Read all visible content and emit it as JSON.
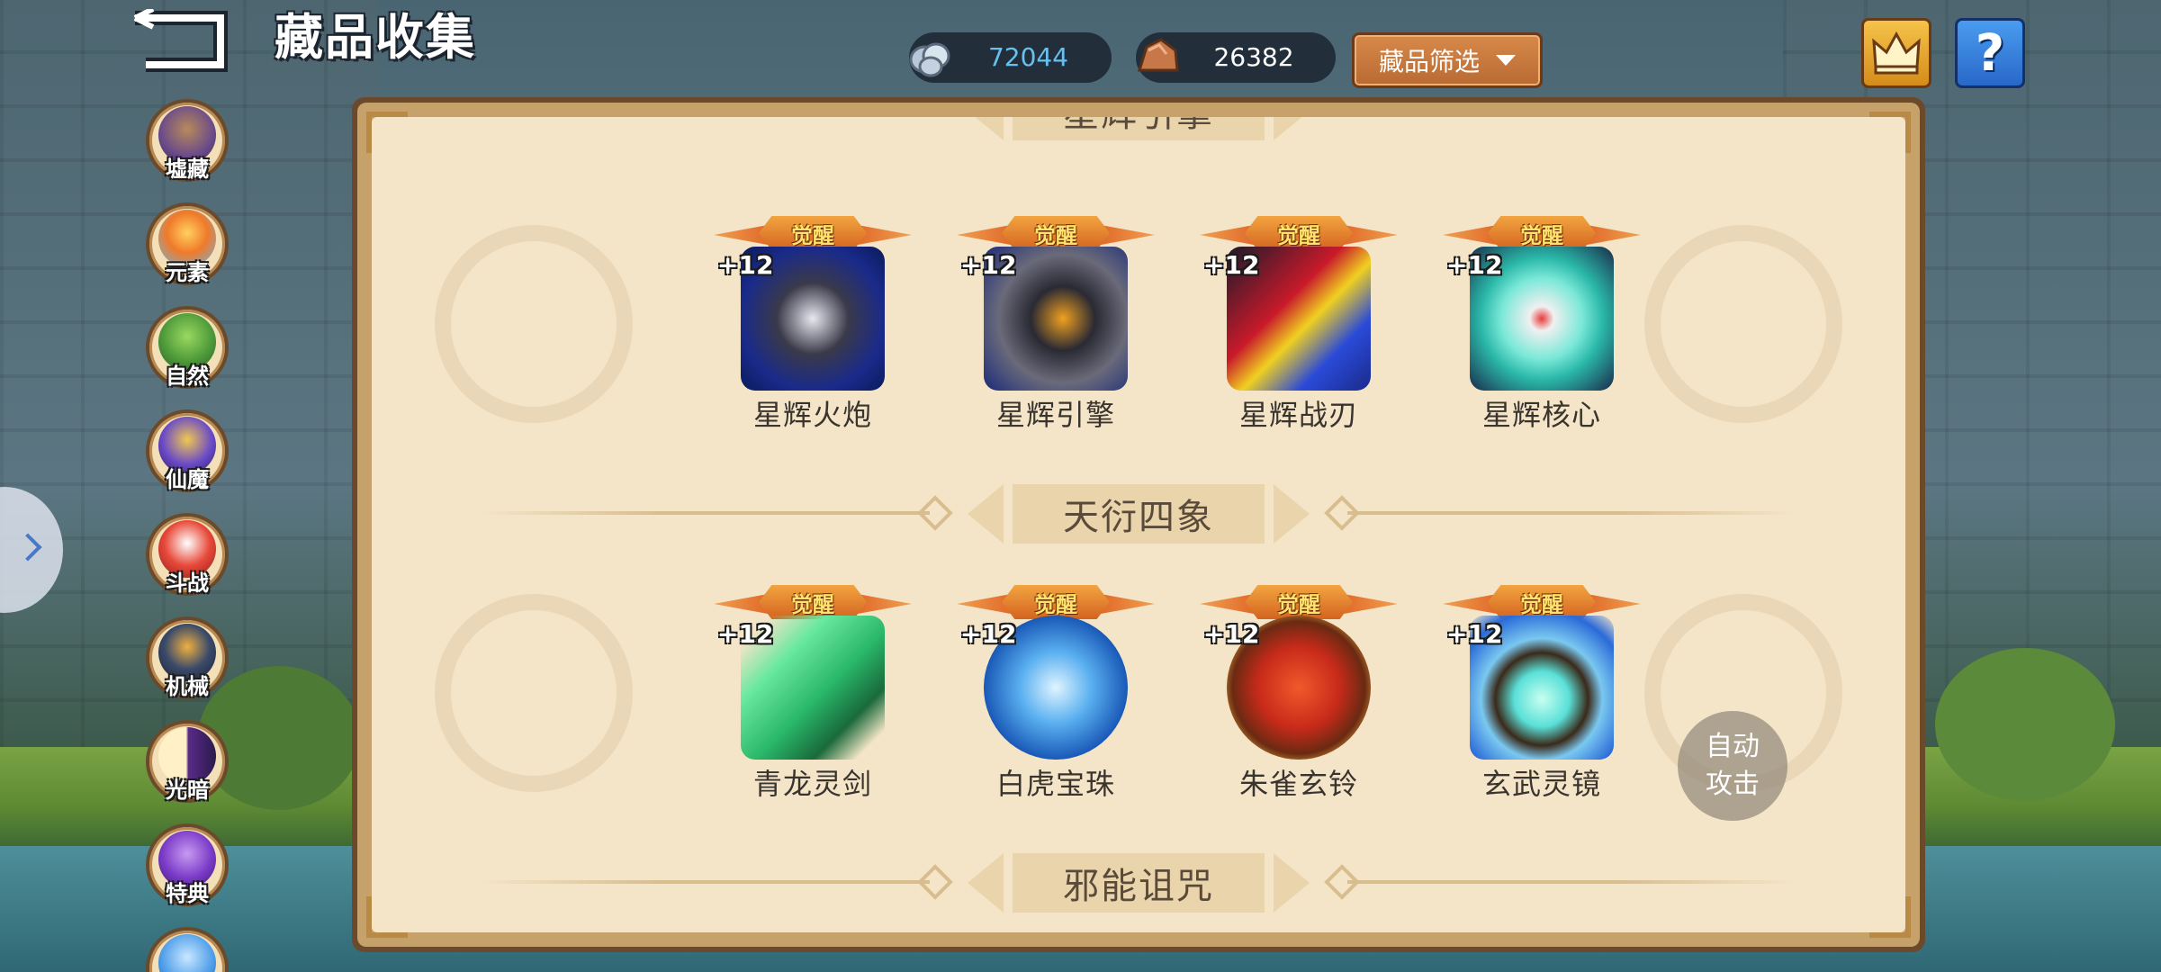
{
  "header": {
    "title": "藏品收集",
    "back_icon": "back-arrow-icon"
  },
  "currencies": [
    {
      "icon": "silver-ore-icon",
      "value": "72044",
      "color": "#67c0f0"
    },
    {
      "icon": "copper-ore-icon",
      "value": "26382",
      "color": "#ffffff"
    }
  ],
  "filter": {
    "label": "藏品筛选",
    "icon": "chevron-down-icon"
  },
  "top_buttons": {
    "crown_icon": "crown-icon",
    "help_label": "?"
  },
  "sidebar": {
    "items": [
      {
        "label": "墟藏",
        "icon": "treasure-chest-icon"
      },
      {
        "label": "元素",
        "icon": "element-flame-icon"
      },
      {
        "label": "自然",
        "icon": "tree-icon"
      },
      {
        "label": "仙魔",
        "icon": "demon-icon"
      },
      {
        "label": "斗战",
        "icon": "battle-orb-icon"
      },
      {
        "label": "机械",
        "icon": "mech-icon"
      },
      {
        "label": "光暗",
        "icon": "light-dark-icon"
      },
      {
        "label": "特典",
        "icon": "special-die-icon"
      }
    ],
    "expand_icon": "chevron-right-icon"
  },
  "sections": [
    {
      "title": "星辉引擎",
      "items": [
        {
          "name": "星辉火炮",
          "badge": "觉醒",
          "level": "+12"
        },
        {
          "name": "星辉引擎",
          "badge": "觉醒",
          "level": "+12"
        },
        {
          "name": "星辉战刃",
          "badge": "觉醒",
          "level": "+12"
        },
        {
          "name": "星辉核心",
          "badge": "觉醒",
          "level": "+12"
        }
      ]
    },
    {
      "title": "天衍四象",
      "items": [
        {
          "name": "青龙灵剑",
          "badge": "觉醒",
          "level": "+12"
        },
        {
          "name": "白虎宝珠",
          "badge": "觉醒",
          "level": "+12"
        },
        {
          "name": "朱雀玄铃",
          "badge": "觉醒",
          "level": "+12"
        },
        {
          "name": "玄武灵镜",
          "badge": "觉醒",
          "level": "+12"
        }
      ]
    },
    {
      "title": "邪能诅咒",
      "items": []
    }
  ],
  "auto_attack": {
    "line1": "自动",
    "line2": "攻击"
  },
  "colors": {
    "panel_paper": "#f4e5c8",
    "panel_frame": "#c6a169",
    "badge_orange": "#e07a2a",
    "currency_blue": "#67c0f0"
  }
}
